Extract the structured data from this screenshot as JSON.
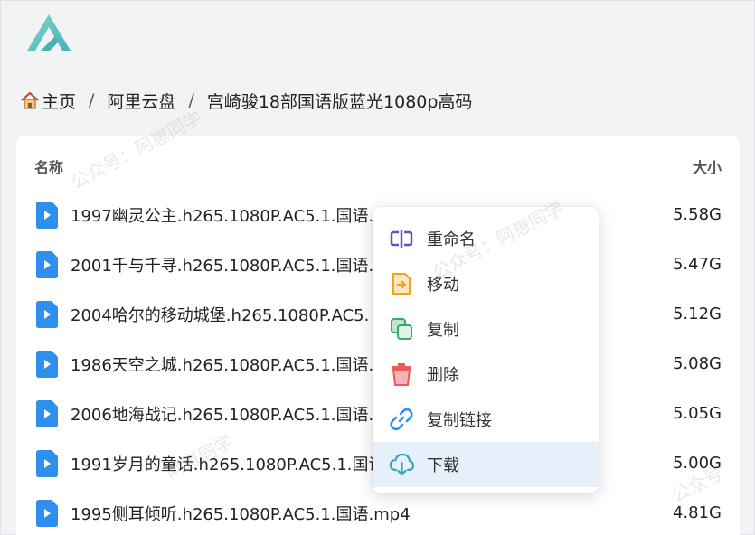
{
  "breadcrumb": {
    "home": "主页",
    "separator": "/",
    "drive": "阿里云盘",
    "folder": "宫崎骏18部国语版蓝光1080p高码"
  },
  "table": {
    "header_name": "名称",
    "header_size": "大小",
    "rows": [
      {
        "name": "1997幽灵公主.h265.1080P.AC5.1.国语.",
        "size": "5.58G"
      },
      {
        "name": "2001千与千寻.h265.1080P.AC5.1.国语.",
        "size": "5.47G"
      },
      {
        "name": "2004哈尔的移动城堡.h265.1080P.AC5.",
        "size": "5.12G"
      },
      {
        "name": "1986天空之城.h265.1080P.AC5.1.国语.",
        "size": "5.08G"
      },
      {
        "name": "2006地海战记.h265.1080P.AC5.1.国语.",
        "size": "5.05G"
      },
      {
        "name": "1991岁月的童话.h265.1080P.AC5.1.国语",
        "size": "5.00G"
      },
      {
        "name": "1995侧耳倾听.h265.1080P.AC5.1.国语.mp4",
        "size": "4.81G"
      }
    ]
  },
  "context_menu": {
    "items": [
      {
        "label": "重命名",
        "icon": "rename-icon"
      },
      {
        "label": "移动",
        "icon": "move-icon"
      },
      {
        "label": "复制",
        "icon": "copy-icon"
      },
      {
        "label": "删除",
        "icon": "trash-icon"
      },
      {
        "label": "复制链接",
        "icon": "link-icon"
      },
      {
        "label": "下载",
        "icon": "cloud-download-icon"
      }
    ],
    "highlighted": "下载"
  },
  "watermark": {
    "text": "公众号：阿崽同学",
    "visible_fragments": [
      "公众号：阿崽同学",
      "公众号：阿崽同学",
      "阿崽同学",
      "公众号"
    ]
  },
  "colors": {
    "background": "#f2f3f5",
    "file_icon": "#2f8fed",
    "menu_highlight": "#e5f0fb",
    "logo_teal": "#5fc3b7"
  }
}
